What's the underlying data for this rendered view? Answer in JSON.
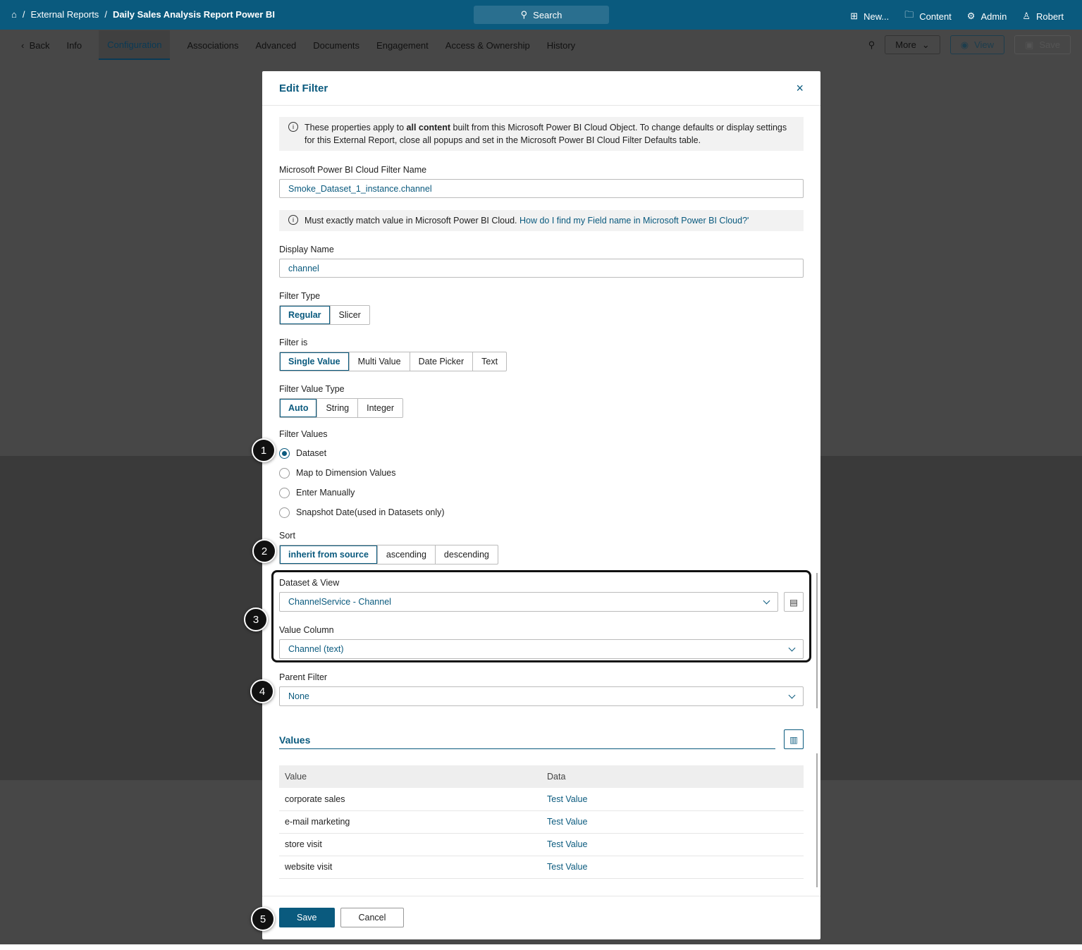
{
  "topbar": {
    "breadcrumb": [
      "External Reports",
      "Daily Sales Analysis Report Power BI"
    ],
    "search": "Search",
    "new": "New...",
    "content": "Content",
    "admin": "Admin",
    "user": "Robert"
  },
  "tabs": {
    "back": "Back",
    "items": [
      "Info",
      "Configuration",
      "Associations",
      "Advanced",
      "Documents",
      "Engagement",
      "Access & Ownership",
      "History"
    ],
    "active": "Configuration",
    "more": "More",
    "view": "View",
    "save": "Save"
  },
  "modal": {
    "title": "Edit Filter",
    "info_pre": "These properties apply to ",
    "info_bold": "all content",
    "info_post": " built from this Microsoft Power BI Cloud Object. To change defaults or display settings for this External Report, close all popups and set in the Microsoft Power BI Cloud Filter Defaults table.",
    "filter_name_label": "Microsoft Power BI Cloud Filter Name",
    "filter_name": "Smoke_Dataset_1_instance.channel",
    "match_note": "Must exactly match value in Microsoft Power BI Cloud. ",
    "match_link": "How do I find my Field name in Microsoft Power BI Cloud?'",
    "display_name_label": "Display Name",
    "display_name": "channel",
    "filter_type_label": "Filter Type",
    "filter_type": [
      "Regular",
      "Slicer"
    ],
    "filter_is_label": "Filter is",
    "filter_is": [
      "Single Value",
      "Multi Value",
      "Date Picker",
      "Text"
    ],
    "value_type_label": "Filter Value Type",
    "value_type": [
      "Auto",
      "String",
      "Integer"
    ],
    "filter_values_label": "Filter Values",
    "filter_values": [
      "Dataset",
      "Map to Dimension Values",
      "Enter Manually",
      "Snapshot Date(used in Datasets only)"
    ],
    "sort_label": "Sort",
    "sort": [
      "inherit from source",
      "ascending",
      "descending"
    ],
    "dataset_label": "Dataset & View",
    "dataset": "ChannelService - Channel",
    "value_column_label": "Value Column",
    "value_column": "Channel (text)",
    "parent_label": "Parent Filter",
    "parent": "None",
    "values_title": "Values",
    "table": {
      "headers": [
        "Value",
        "Data"
      ],
      "rows": [
        [
          "corporate sales",
          "Test Value"
        ],
        [
          "e-mail marketing",
          "Test Value"
        ],
        [
          "store visit",
          "Test Value"
        ],
        [
          "website visit",
          "Test Value"
        ]
      ]
    },
    "save": "Save",
    "cancel": "Cancel"
  },
  "badges": [
    "1",
    "2",
    "3",
    "4",
    "5"
  ]
}
